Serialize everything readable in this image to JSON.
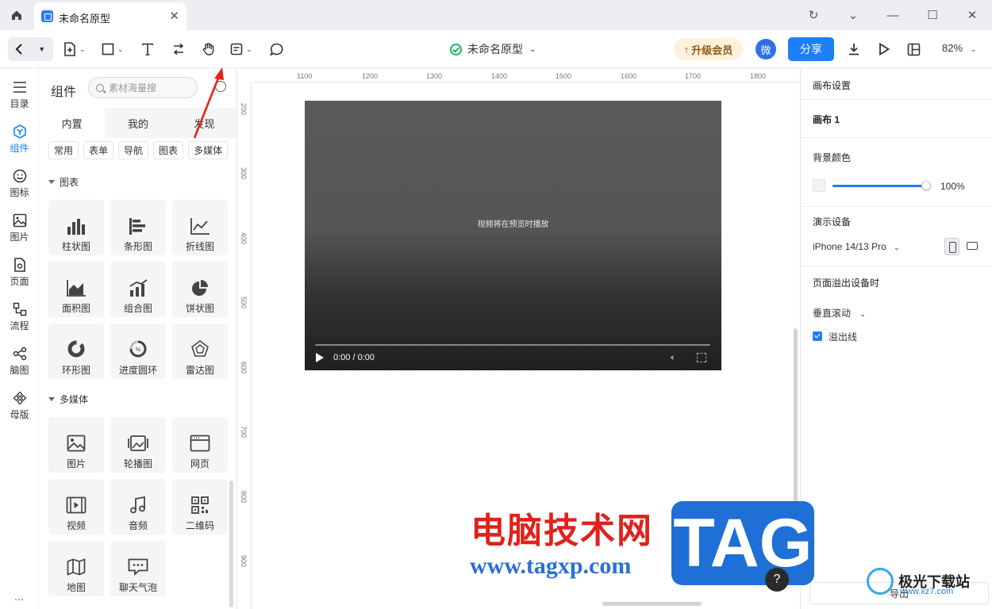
{
  "window": {
    "tab_title": "未命名原型",
    "controls": [
      "refresh",
      "dropdown",
      "minimize",
      "maximize",
      "close"
    ]
  },
  "toolbar": {
    "doc_name": "未命名原型",
    "upgrade_label": "升级会员",
    "avatar_label": "微",
    "share_label": "分享",
    "zoom": "82%"
  },
  "rail": {
    "items": [
      {
        "label": "目录",
        "icon": "list-icon"
      },
      {
        "label": "组件",
        "icon": "component-icon",
        "active": true
      },
      {
        "label": "图标",
        "icon": "smile-icon"
      },
      {
        "label": "图片",
        "icon": "image-icon"
      },
      {
        "label": "页面",
        "icon": "page-icon"
      },
      {
        "label": "流程",
        "icon": "flow-icon"
      },
      {
        "label": "脑图",
        "icon": "mindmap-icon"
      },
      {
        "label": "母版",
        "icon": "master-icon"
      }
    ],
    "more": "..."
  },
  "panel": {
    "title": "组件",
    "search_placeholder": "素材海量搜",
    "tabs": [
      "内置",
      "我的",
      "发现"
    ],
    "active_tab": "内置",
    "chips": [
      "常用",
      "表单",
      "导航",
      "图表",
      "多媒体"
    ],
    "sections": [
      {
        "title": "图表",
        "items": [
          "柱状图",
          "条形图",
          "折线图",
          "面积图",
          "组合图",
          "饼状图",
          "环形图",
          "进度圆环",
          "雷达图"
        ]
      },
      {
        "title": "多媒体",
        "items": [
          "图片",
          "轮播图",
          "网页",
          "视频",
          "音频",
          "二维码",
          "地图",
          "聊天气泡"
        ]
      }
    ]
  },
  "canvas": {
    "ruler_x": [
      "1100",
      "1200",
      "1300",
      "1400",
      "1500",
      "1600",
      "1700",
      "1800"
    ],
    "ruler_y": [
      "200",
      "300",
      "400",
      "500",
      "600",
      "700",
      "800",
      "900"
    ],
    "video_hint": "视频将在预览时播放",
    "video_time": "0:00 / 0:00"
  },
  "right_panel": {
    "canvas_settings": "画布设置",
    "canvas_name": "画布 1",
    "bg_color_label": "背景颜色",
    "bg_opacity": "100%",
    "device_label": "演示设备",
    "device_value": "iPhone 14/13 Pro",
    "overflow_label": "页面溢出设备时",
    "scroll_mode": "垂直滚动",
    "overflow_line_label": "溢出线",
    "overflow_line_checked": true,
    "export_label": "导出"
  },
  "watermark": {
    "site_cn": "电脑技术网",
    "site_url": "www.tagxp.com",
    "tag": "TAG",
    "corner_name": "极光下载站",
    "corner_url": "www.xz7.com"
  },
  "colors": {
    "accent": "#1e7ef8",
    "upgrade_bg": "#fdf1dc",
    "watermark_red": "#e0221c",
    "watermark_blue": "#1e6fd6"
  }
}
